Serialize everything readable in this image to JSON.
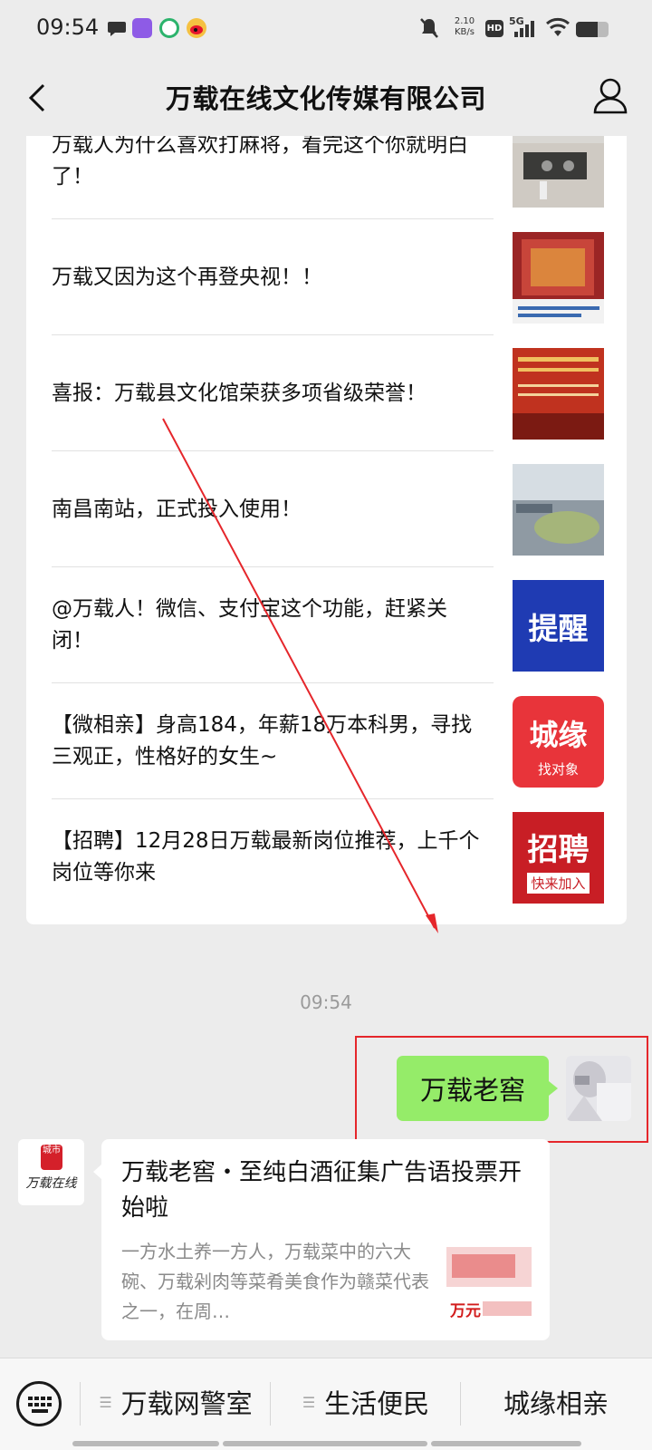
{
  "status_bar": {
    "time": "09:54",
    "net_speed": "2.10",
    "net_unit": "KB/s",
    "hd": "HD",
    "signal": "5G"
  },
  "nav": {
    "title": "万载在线文化传媒有限公司"
  },
  "articles": [
    {
      "title": "万载人为什么喜欢打麻将，看完这个你就明白了！"
    },
    {
      "title": "万载又因为这个再登央视！！"
    },
    {
      "title": "喜报：万载县文化馆荣获多项省级荣誉！"
    },
    {
      "title": "南昌南站，正式投入使用！"
    },
    {
      "title": "@万载人！微信、支付宝这个功能，赶紧关闭！",
      "thumb_text": "提醒"
    },
    {
      "title": "【微相亲】身高184，年薪18万本科男，寻找三观正，性格好的女生~",
      "thumb_text": "城缘",
      "thumb_sub": "找对象"
    },
    {
      "title": "【招聘】12月28日万载最新岗位推荐，上千个岗位等你来",
      "thumb_text": "招聘",
      "thumb_sub": "快来加入"
    }
  ],
  "chat": {
    "time": "09:54",
    "my_message": "万载老窖",
    "oa_logo_text": "万载在线",
    "oa_logo_badge": "城市",
    "card_title": "万载老窖・至纯白酒征集广告语投票开始啦",
    "card_desc": "一方水土养一方人，万载菜中的六大碗、万载剁肉等菜肴美食作为赣菜代表之一，在周…",
    "card_thumb_text": "万元"
  },
  "menu": {
    "items": [
      "万载网警室",
      "生活便民",
      "城缘相亲"
    ]
  },
  "colors": {
    "bubble_green": "#95ec69",
    "annotation_red": "#e5262b"
  }
}
